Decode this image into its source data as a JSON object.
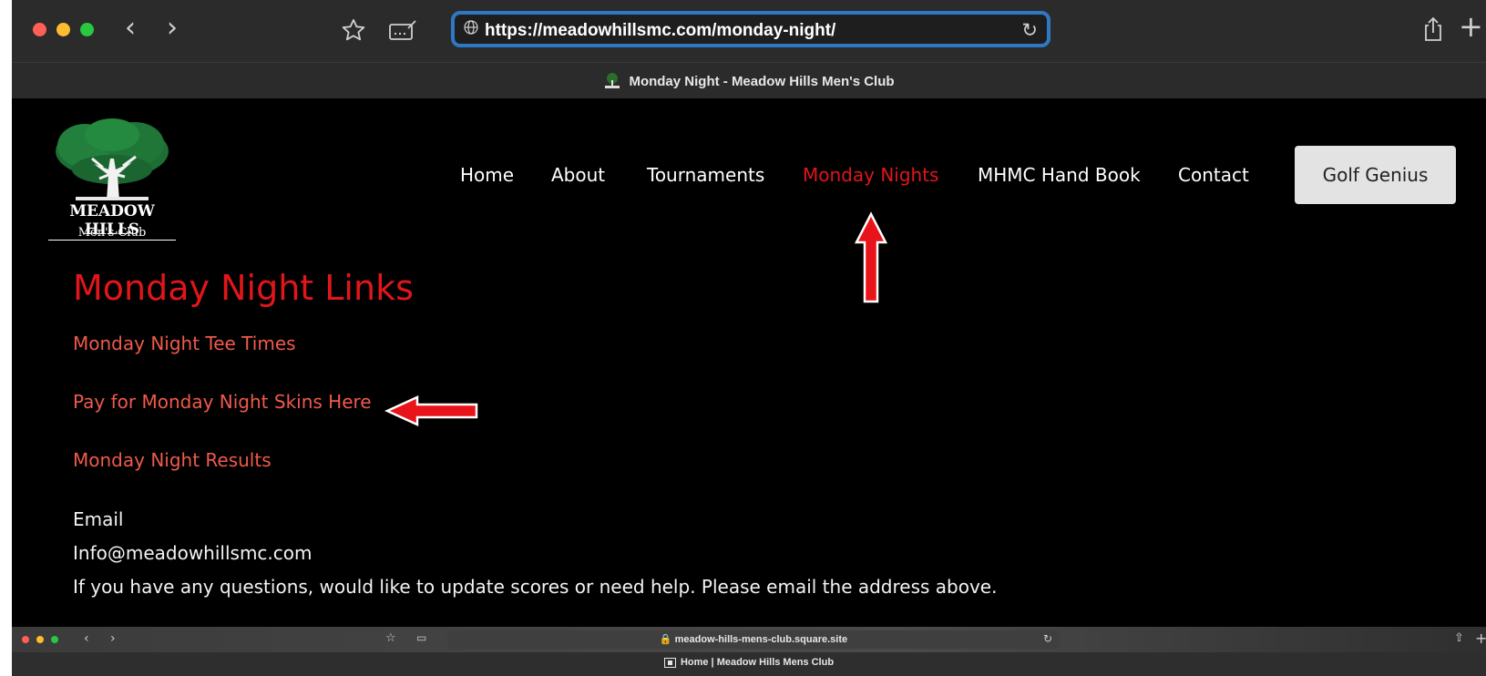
{
  "browser": {
    "url": "https://meadowhillsmc.com/monday-night/",
    "tab_title": "Monday Night - Meadow Hills Men's Club"
  },
  "site": {
    "logo_name": "MEADOW HILLS",
    "logo_sub": "Men's Club",
    "nav": [
      "Home",
      "About",
      "Tournaments",
      "Monday Nights",
      "MHMC Hand Book",
      "Contact"
    ],
    "active_nav": "Monday Nights",
    "cta_label": "Golf Genius"
  },
  "content": {
    "heading": "Monday Night Links",
    "links": [
      "Monday Night Tee Times",
      "Pay for Monday Night Skins Here",
      "Monday Night Results"
    ],
    "email_label": "Email",
    "email_address": "Info@meadowhillsmc.com",
    "help_text": "If you have any questions, would like to update scores or need help. Please email the address above."
  },
  "second_browser": {
    "url": "meadow-hills-mens-club.square.site",
    "tab_title": "Home | Meadow Hills Mens Club"
  },
  "colors": {
    "accent_red": "#e0161b",
    "link_red": "#f05a4b",
    "url_focus_blue": "#2e79c4"
  },
  "icons": [
    "back-icon",
    "forward-icon",
    "star-icon",
    "reader-icon",
    "globe-icon",
    "reload-icon",
    "share-icon",
    "new-tab-icon",
    "lock-icon",
    "arrow-annotation"
  ]
}
